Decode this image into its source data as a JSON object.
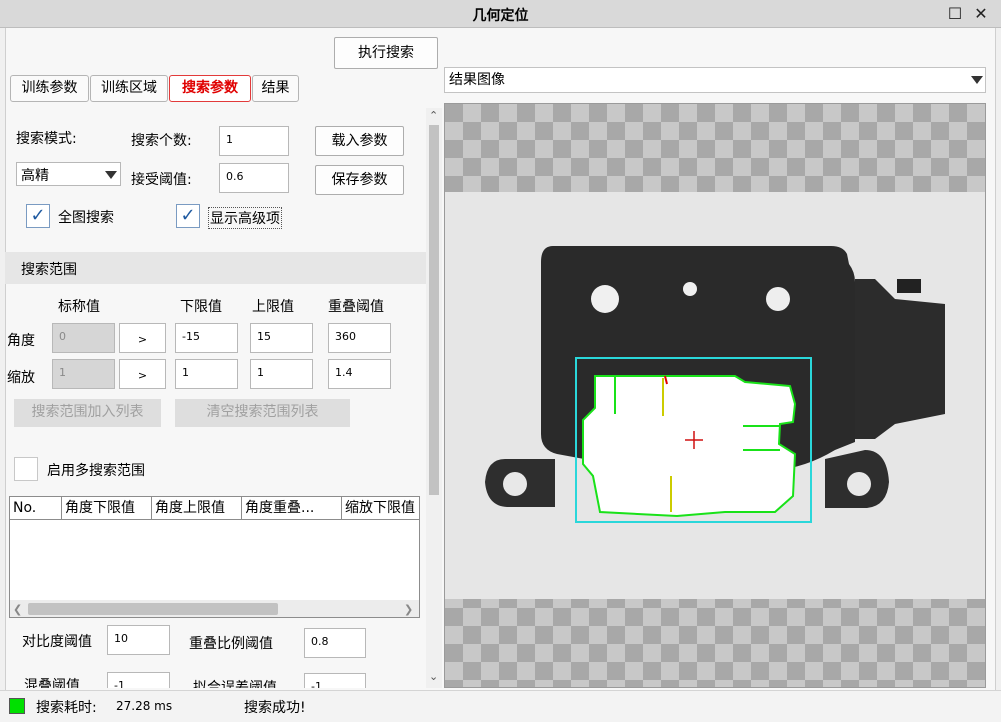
{
  "window": {
    "title": "几何定位"
  },
  "toolbar": {
    "execute_label": "执行搜索"
  },
  "tabs": [
    {
      "label": "训练参数"
    },
    {
      "label": "训练区域"
    },
    {
      "label": "搜索参数",
      "active": true
    },
    {
      "label": "结果"
    }
  ],
  "search": {
    "mode_label": "搜索模式:",
    "mode_value": "高精",
    "count_label": "搜索个数:",
    "count_value": "1",
    "threshold_label": "接受阈值:",
    "threshold_value": "0.6",
    "load_label": "载入参数",
    "save_label": "保存参数",
    "full_image_label": "全图搜索",
    "full_image_checked": true,
    "advanced_label": "显示高级项",
    "advanced_checked": true
  },
  "range": {
    "header": "搜索范围",
    "col_nominal": "标称值",
    "col_lower": "下限值",
    "col_upper": "上限值",
    "col_overlap": "重叠阈值",
    "angle_label": "角度",
    "angle_nominal": "0",
    "angle_arrow": ">",
    "angle_lower": "-15",
    "angle_upper": "15",
    "angle_overlap": "360",
    "scale_label": "缩放",
    "scale_nominal": "1",
    "scale_arrow": ">",
    "scale_lower": "1",
    "scale_upper": "1",
    "scale_overlap": "1.4",
    "add_label": "搜索范围加入列表",
    "clear_label": "清空搜索范围列表",
    "multi_label": "启用多搜索范围",
    "multi_checked": false
  },
  "table": {
    "columns": [
      "No.",
      "角度下限值",
      "角度上限值",
      "角度重叠...",
      "缩放下限值"
    ]
  },
  "advanced": {
    "contrast_label": "对比度阈值",
    "contrast_value": "10",
    "overlap_ratio_label": "重叠比例阈值",
    "overlap_ratio_value": "0.8",
    "clutter_label": "混叠阈值",
    "clutter_value": "-1",
    "fit_label": "拟合误差阈值",
    "fit_value": "-1"
  },
  "image": {
    "selector_value": "结果图像"
  },
  "status": {
    "indicator_color": "#00e000",
    "time_label": "搜索耗时:",
    "time_value": "27.28 ms",
    "message": "搜索成功!"
  }
}
